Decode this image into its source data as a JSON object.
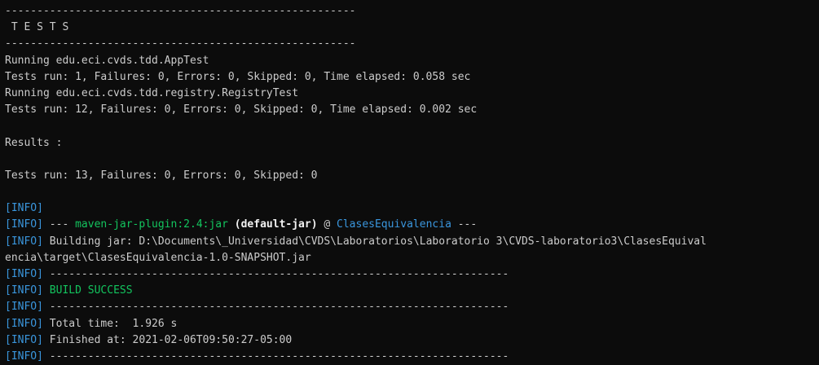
{
  "terminal": {
    "tests_header": {
      "rule_top": "-------------------------------------------------------",
      "title": " T E S T S",
      "rule_bottom": "-------------------------------------------------------"
    },
    "test_runs": [
      {
        "running": "Running edu.eci.cvds.tdd.AppTest",
        "result": "Tests run: 1, Failures: 0, Errors: 0, Skipped: 0, Time elapsed: 0.058 sec"
      },
      {
        "running": "Running edu.eci.cvds.tdd.registry.RegistryTest",
        "result": "Tests run: 12, Failures: 0, Errors: 0, Skipped: 0, Time elapsed: 0.002 sec"
      }
    ],
    "results_label": "Results :",
    "results_summary": "Tests run: 13, Failures: 0, Errors: 0, Skipped: 0",
    "info_tag": "[INFO]",
    "plugin": {
      "prefix": " --- ",
      "name": "maven-jar-plugin:2.4:jar",
      "execution": "(default-jar)",
      "at": " @ ",
      "project": "ClasesEquivalencia",
      "suffix": " ---"
    },
    "building_jar_line1": " Building jar: D:\\Documents\\_Universidad\\CVDS\\Laboratorios\\Laboratorio 3\\CVDS-laboratorio3\\ClasesEquival",
    "building_jar_line2": "encia\\target\\ClasesEquivalencia-1.0-SNAPSHOT.jar",
    "info_rule": " ------------------------------------------------------------------------",
    "build_status": "BUILD SUCCESS",
    "total_time": " Total time:  1.926 s",
    "finished_at": " Finished at: 2021-02-06T09:50:27-05:00",
    "colors": {
      "background": "#0c0c0c",
      "text": "#cccccc",
      "info_tag": "#3a96dd",
      "plugin": "#13c45e",
      "success": "#13c45e",
      "project": "#3a96dd"
    }
  }
}
